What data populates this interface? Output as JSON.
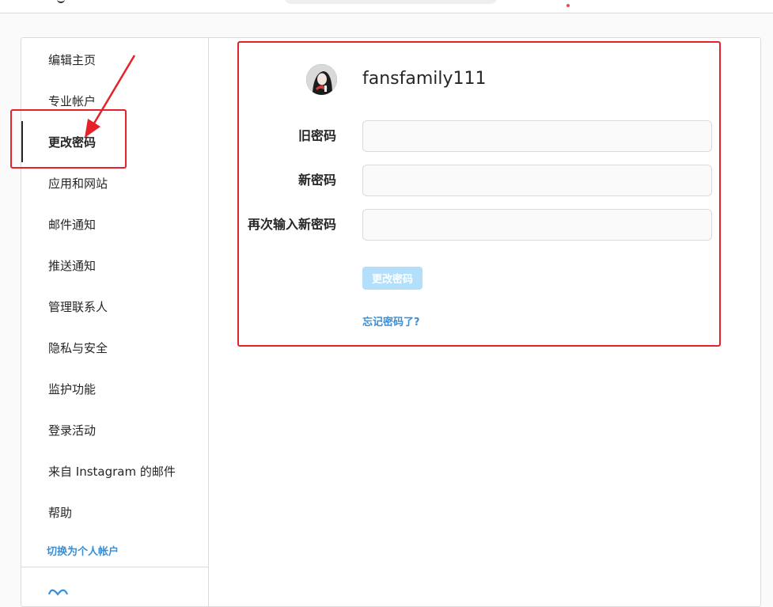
{
  "sidebar": {
    "items": [
      {
        "label": "编辑主页"
      },
      {
        "label": "专业帐户"
      },
      {
        "label": "更改密码"
      },
      {
        "label": "应用和网站"
      },
      {
        "label": "邮件通知"
      },
      {
        "label": "推送通知"
      },
      {
        "label": "管理联系人"
      },
      {
        "label": "隐私与安全"
      },
      {
        "label": "监护功能"
      },
      {
        "label": "登录活动"
      },
      {
        "label": "来自 Instagram 的邮件"
      },
      {
        "label": "帮助"
      }
    ],
    "switch_label": "切换为个人帐户"
  },
  "main": {
    "username": "fansfamily111",
    "fields": [
      {
        "label": "旧密码",
        "value": ""
      },
      {
        "label": "新密码",
        "value": ""
      },
      {
        "label": "再次输入新密码",
        "value": ""
      }
    ],
    "submit_label": "更改密码",
    "forgot_label": "忘记密码了?"
  },
  "colors": {
    "annotation": "#e5212a",
    "link": "#3a8ed6",
    "button_disabled": "#b2dffc"
  }
}
